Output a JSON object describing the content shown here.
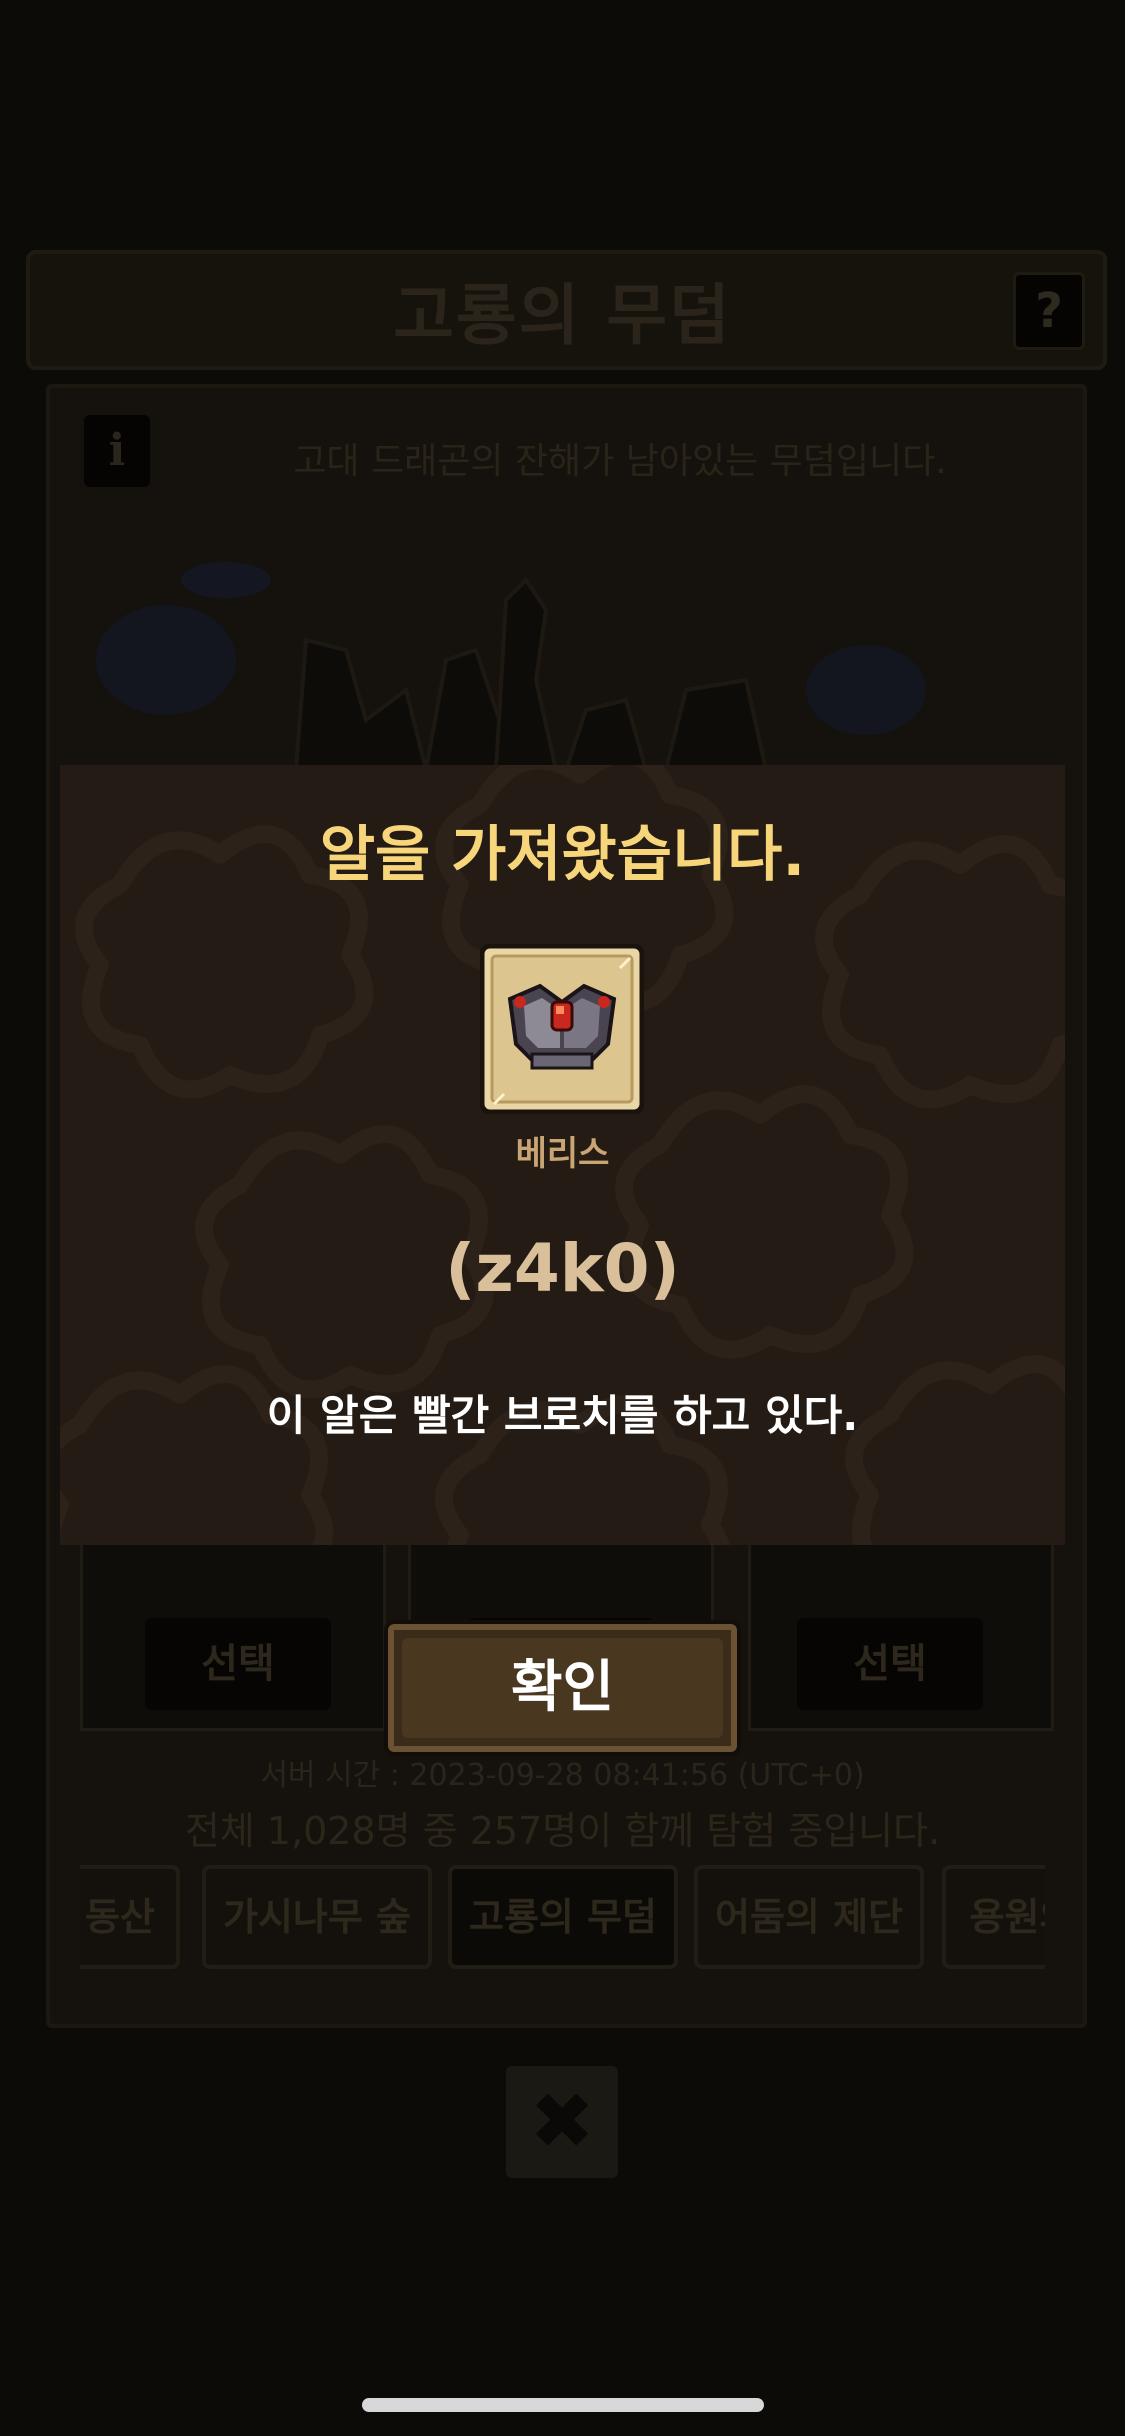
{
  "background": {
    "title": "고룡의 무덤",
    "help_icon": "?",
    "info_icon": "i",
    "description": "고대 드래곤의 잔해가 남아있는 무덤입니다.",
    "select_label": "선택",
    "server_time": "서버 시간 : 2023-09-28 08:41:56 (UTC+0)",
    "participants": "전체 1,028명 중 257명이 함께 탐험 중입니다.",
    "tabs": [
      {
        "label": "동산"
      },
      {
        "label": "가시나무 숲"
      },
      {
        "label": "고룡의 무덤"
      },
      {
        "label": "어둠의 제단"
      },
      {
        "label": "용원의"
      }
    ],
    "close_icon": "✖"
  },
  "modal": {
    "title": "알을 가져왔습니다.",
    "item_name": "베리스",
    "egg_code": "(z4k0)",
    "egg_description": "이 알은 빨간 브로치를 하고 있다.",
    "confirm_label": "확인"
  },
  "colors": {
    "modal_bg": "#231b14",
    "title_yellow": "#f7d57a",
    "item_name": "#c9a474",
    "egg_code": "#d9c09a"
  }
}
